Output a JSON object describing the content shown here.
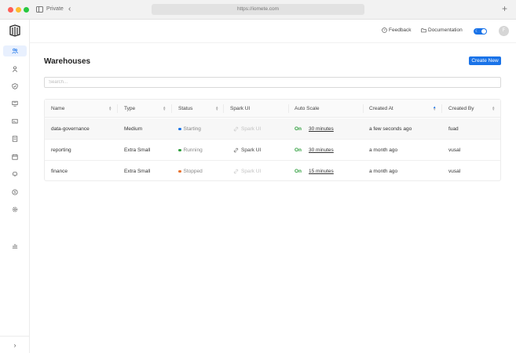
{
  "browser": {
    "profile": "Private",
    "url": "https://iomete.com"
  },
  "header": {
    "feedback": "Feedback",
    "documentation": "Documentation",
    "avatar_initial": "F"
  },
  "page": {
    "title": "Warehouses",
    "create_button": "Create New",
    "search_placeholder": "Search..."
  },
  "table": {
    "columns": [
      "Name",
      "Type",
      "Status",
      "Spark UI",
      "Auto Scale",
      "Created At",
      "Created By"
    ],
    "rows": [
      {
        "name": "data-governance",
        "type": "Medium",
        "status": "Starting",
        "status_color": "#1a73e8",
        "spark_ui": "Spark UI",
        "spark_ui_enabled": false,
        "auto_scale": "On",
        "minutes": "30 minutes",
        "created_at": "a few seconds ago",
        "created_by": "fuad"
      },
      {
        "name": "reporting",
        "type": "Extra Small",
        "status": "Running",
        "status_color": "#2e9e3c",
        "spark_ui": "Spark UI",
        "spark_ui_enabled": true,
        "auto_scale": "On",
        "minutes": "30 minutes",
        "created_at": "a month ago",
        "created_by": "vusal"
      },
      {
        "name": "finance",
        "type": "Extra Small",
        "status": "Stopped",
        "status_color": "#e8712c",
        "spark_ui": "Spark UI",
        "spark_ui_enabled": false,
        "auto_scale": "On",
        "minutes": "15 minutes",
        "created_at": "a month ago",
        "created_by": "vusal"
      }
    ]
  },
  "colors": {
    "accent": "#1a73e8",
    "running": "#2e9e3c",
    "stopped": "#e8712c"
  }
}
